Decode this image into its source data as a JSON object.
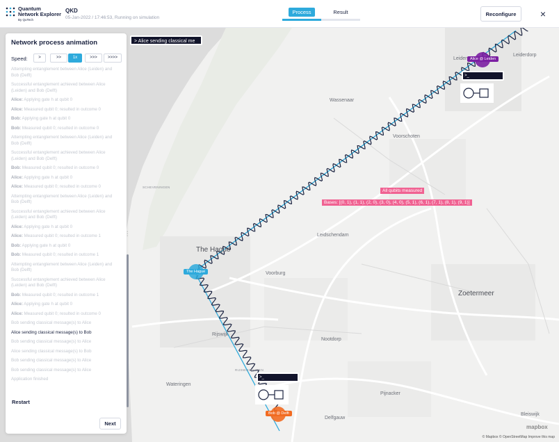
{
  "header": {
    "logo_line1": "Quantum",
    "logo_line2": "Network Explorer",
    "logo_line3": "By QuTech",
    "app_title": "QKD",
    "app_subtitle": "05-Jan-2022 / 17:46:53, Running on simulation",
    "tabs": [
      {
        "label": "Process",
        "active": true
      },
      {
        "label": "Result",
        "active": false
      }
    ],
    "reconfigure_label": "Reconfigure",
    "close_icon": "×"
  },
  "map": {
    "console_text": "> Alice sending classical me",
    "labels": {
      "leiden": "Leiden",
      "leiderdorp": "Leiderdorp",
      "wassenaar": "Wassenaar",
      "voorschoten": "Voorschoten",
      "the_hague": "The Hague",
      "leidschendam": "Leidschendam",
      "voorburg": "Voorburg",
      "zoetermeer": "Zoetermeer",
      "rijswijk": "Rijswijk",
      "nootdorp": "Nootdorp",
      "wateringen": "Wateringen",
      "pijnacker": "Pijnacker",
      "delfgauw": "Delfgauw",
      "bleiswijk": "Bleiswijk",
      "scheveningen": "SCHEVENINGEN",
      "rijswijkbuiten": "RIJSWIJKBUITEN"
    },
    "nodes": {
      "alice": {
        "label": "Alice @ Leiden",
        "color": "#7b1fa2"
      },
      "hague": {
        "label": "The Hague",
        "color": "#2eaadc"
      },
      "bob": {
        "label": "Bob @ Delft",
        "color": "#f26b21"
      }
    },
    "alice_console": ">_",
    "bob_console": ">_",
    "tag_measured": "All qubits measured",
    "tag_bases": "Bases: [(0, 1), (1, 1), (2, 0), (3, 0), (4, 0), (5, 1), (6, 1), (7, 1), (8, 1), (9, 1)]",
    "attribution": "© Mapbox © OpenStreetMap Improve this map",
    "mapbox_logo": "mapbox"
  },
  "panel": {
    "title": "Network process animation",
    "speed_label": "Speed:",
    "speed_options": [
      {
        "label": ">",
        "active": false
      },
      {
        "label": ">>",
        "active": false
      },
      {
        "label": "1x",
        "active": true
      },
      {
        "label": ">>>",
        "active": false
      },
      {
        "label": ">>>>",
        "active": false
      }
    ],
    "log": [
      {
        "who": "",
        "text": "Attempting entanglement between Alice (Leiden) and Bob (Delft)",
        "current": false,
        "lines": 2
      },
      {
        "who": "",
        "text": "Successful entanglement achieved between Alice (Leiden) and Bob (Delft)",
        "current": false,
        "lines": 2
      },
      {
        "who": "Alice:",
        "text": " Applying gate h at qubit 0",
        "current": false,
        "lines": 1
      },
      {
        "who": "Alice:",
        "text": " Measured qubit 0; resulted in outcome 0",
        "current": false,
        "lines": 1
      },
      {
        "who": "Bob:",
        "text": " Applying gate h at qubit 0",
        "current": false,
        "lines": 1
      },
      {
        "who": "Bob:",
        "text": " Measured qubit 0; resulted in outcome 0",
        "current": false,
        "lines": 1
      },
      {
        "who": "",
        "text": "Attempting entanglement between Alice (Leiden) and Bob (Delft)",
        "current": false,
        "lines": 2
      },
      {
        "who": "",
        "text": "Successful entanglement achieved between Alice (Leiden) and Bob (Delft)",
        "current": false,
        "lines": 2
      },
      {
        "who": "Bob:",
        "text": " Measured qubit 0; resulted in outcome 0",
        "current": false,
        "lines": 1
      },
      {
        "who": "Alice:",
        "text": " Applying gate h at qubit 0",
        "current": false,
        "lines": 1
      },
      {
        "who": "Alice:",
        "text": " Measured qubit 0; resulted in outcome 0",
        "current": false,
        "lines": 1
      },
      {
        "who": "",
        "text": "Attempting entanglement between Alice (Leiden) and Bob (Delft)",
        "current": false,
        "lines": 2
      },
      {
        "who": "",
        "text": "Successful entanglement achieved between Alice (Leiden) and Bob (Delft)",
        "current": false,
        "lines": 2
      },
      {
        "who": "Alice:",
        "text": " Applying gate h at qubit 0",
        "current": false,
        "lines": 1
      },
      {
        "who": "Alice:",
        "text": " Measured qubit 0; resulted in outcome 1",
        "current": false,
        "lines": 1
      },
      {
        "who": "Bob:",
        "text": " Applying gate h at qubit 0",
        "current": false,
        "lines": 1
      },
      {
        "who": "Bob:",
        "text": " Measured qubit 0; resulted in outcome 1",
        "current": false,
        "lines": 1
      },
      {
        "who": "",
        "text": "Attempting entanglement between Alice (Leiden) and Bob (Delft)",
        "current": false,
        "lines": 2
      },
      {
        "who": "",
        "text": "Successful entanglement achieved between Alice (Leiden) and Bob (Delft)",
        "current": false,
        "lines": 2
      },
      {
        "who": "Bob:",
        "text": " Measured qubit 0; resulted in outcome 1",
        "current": false,
        "lines": 1
      },
      {
        "who": "Alice:",
        "text": " Applying gate h at qubit 0",
        "current": false,
        "lines": 1
      },
      {
        "who": "Alice:",
        "text": " Measured qubit 0; resulted in outcome 0",
        "current": false,
        "lines": 1
      },
      {
        "who": "",
        "text": "Bob sending classical message(s) to Alice",
        "current": false,
        "lines": 1
      },
      {
        "who": "",
        "text": "Alice sending classical message(s) to Bob",
        "current": true,
        "lines": 1
      },
      {
        "who": "",
        "text": "Bob sending classical message(s) to Alice",
        "current": false,
        "lines": 1
      },
      {
        "who": "",
        "text": "Alice sending classical message(s) to Bob",
        "current": false,
        "lines": 1
      },
      {
        "who": "",
        "text": "Bob sending classical message(s) to Alice",
        "current": false,
        "lines": 1
      },
      {
        "who": "",
        "text": "Bob sending classical message(s) to Alice",
        "current": false,
        "lines": 1
      },
      {
        "who": "",
        "text": "Application finished",
        "current": false,
        "lines": 1
      }
    ],
    "restart_label": "Restart",
    "next_label": "Next"
  }
}
